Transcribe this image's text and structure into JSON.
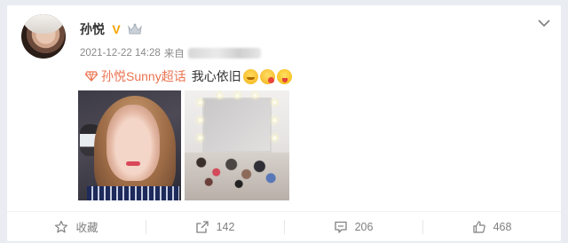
{
  "post": {
    "username": "孙悦",
    "verify_mark": "V",
    "timestamp": "2021-12-22 14:28",
    "source_prefix": "来自",
    "topic": "孙悦Sunny超话",
    "text": "我心依旧"
  },
  "actions": {
    "favorite_label": "收藏",
    "repost_count": "142",
    "comment_count": "206",
    "like_count": "468"
  },
  "icons": {
    "verify": "verified-v-icon",
    "crown": "crown-icon",
    "menu": "chevron-down-icon",
    "topic": "diamond-topic-icon",
    "favorite": "star-icon",
    "repost": "share-icon",
    "comment": "comment-icon",
    "like": "thumbs-up-icon"
  },
  "colors": {
    "topic_link": "#eb7350",
    "verify_badge": "#f5a500",
    "text": "#333333",
    "meta": "#8a8a8a"
  }
}
